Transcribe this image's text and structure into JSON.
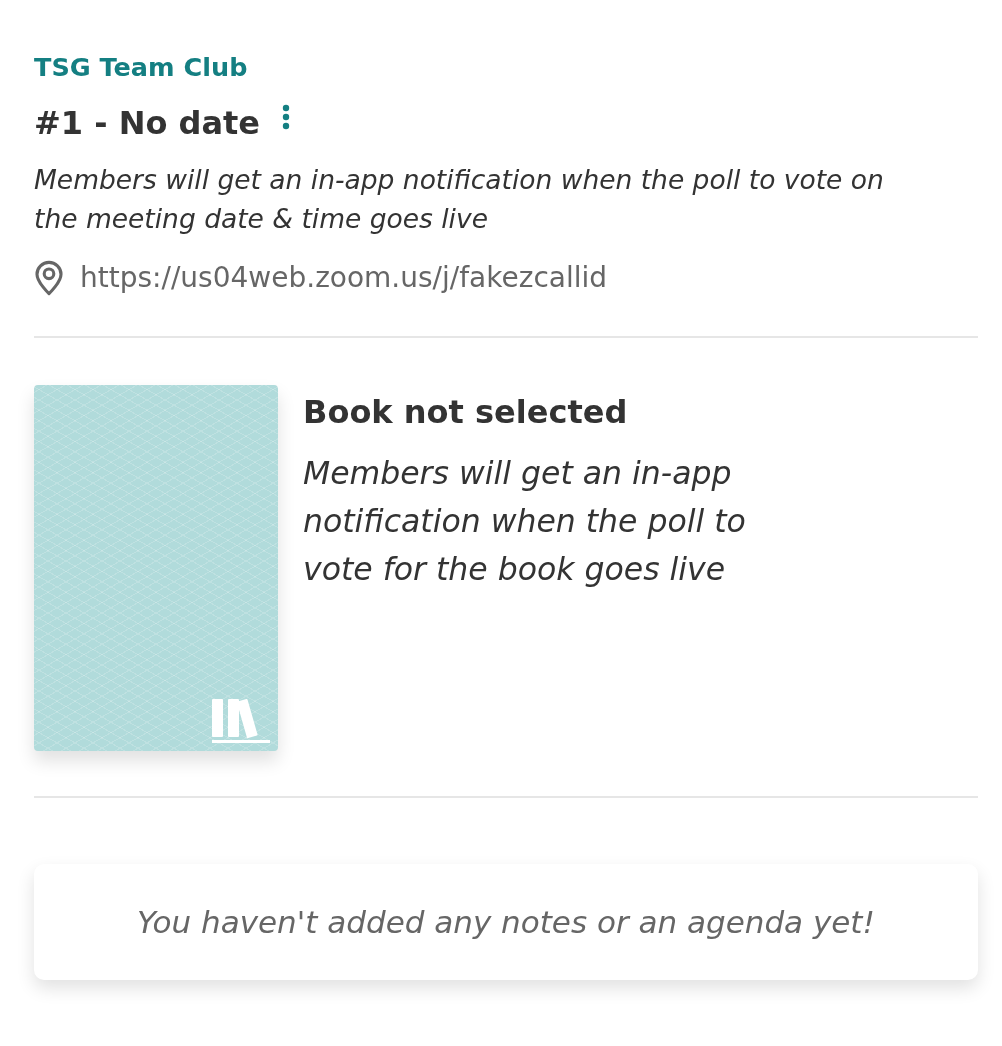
{
  "club_name": "TSG Team Club",
  "meeting": {
    "title": "#1 - No date",
    "description": "Members will get an in-app notification when the poll to vote on the meeting date & time goes live",
    "location": "https://us04web.zoom.us/j/fakezcallid"
  },
  "book": {
    "title": "Book not selected",
    "description": "Members will get an in-app notification when the poll to vote for the book goes live"
  },
  "notes": {
    "empty_message": "You haven't added any notes or an agenda yet!"
  }
}
